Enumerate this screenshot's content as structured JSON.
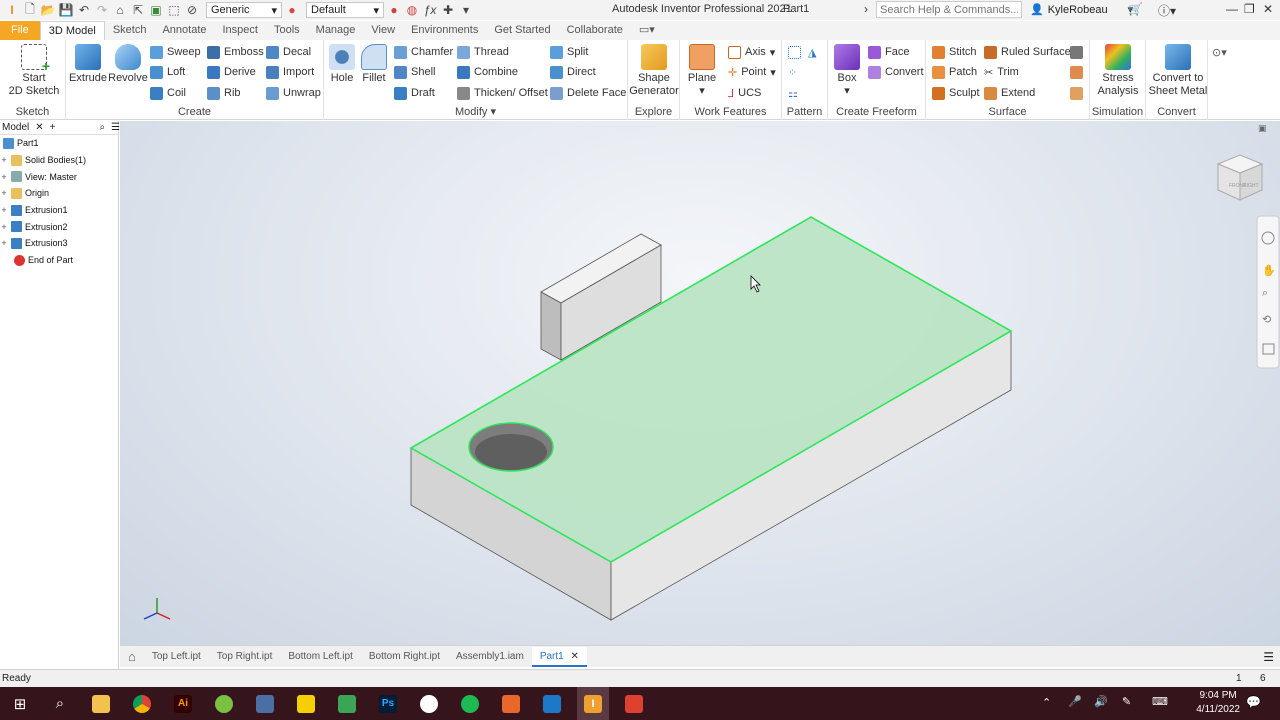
{
  "title_bar": {
    "app_title": "Autodesk Inventor Professional 2021",
    "doc_title": "Part1",
    "material": "Generic",
    "appearance": "Default",
    "search_placeholder": "Search Help & Commands...",
    "user": "KyleRobeau"
  },
  "ribbon_tabs": [
    "File",
    "3D Model",
    "Sketch",
    "Annotate",
    "Inspect",
    "Tools",
    "Manage",
    "View",
    "Environments",
    "Get Started",
    "Collaborate"
  ],
  "ribbon": {
    "sketch": {
      "label": "Sketch",
      "start": "Start",
      "start2": "2D Sketch"
    },
    "create": {
      "label": "Create",
      "extrude": "Extrude",
      "revolve": "Revolve",
      "sweep": "Sweep",
      "emboss": "Emboss",
      "decal": "Decal",
      "loft": "Loft",
      "derive": "Derive",
      "import": "Import",
      "coil": "Coil",
      "rib": "Rib",
      "unwrap": "Unwrap"
    },
    "modify": {
      "label": "Modify",
      "hole": "Hole",
      "fillet": "Fillet",
      "chamfer": "Chamfer",
      "thread": "Thread",
      "split": "Split",
      "shell": "Shell",
      "combine": "Combine",
      "direct": "Direct",
      "draft": "Draft",
      "thicken": "Thicken/ Offset",
      "delete_face": "Delete Face"
    },
    "explore": {
      "label": "Explore",
      "shape1": "Shape",
      "shape2": "Generator"
    },
    "work": {
      "label": "Work Features",
      "plane": "Plane",
      "axis": "Axis",
      "point": "Point",
      "ucs": "UCS"
    },
    "pattern": {
      "label": "Pattern"
    },
    "freeform": {
      "label": "Create Freeform",
      "box": "Box",
      "face": "Face",
      "convert": "Convert"
    },
    "surface": {
      "label": "Surface",
      "stitch": "Stitch",
      "ruled": "Ruled Surface",
      "patch": "Patch",
      "trim": "Trim",
      "sculpt": "Sculpt",
      "extend": "Extend"
    },
    "simulation": {
      "label": "Simulation",
      "stress1": "Stress",
      "stress2": "Analysis"
    },
    "convert": {
      "label": "Convert",
      "c1": "Convert to",
      "c2": "Sheet Metal"
    }
  },
  "browser": {
    "tab": "Model",
    "items": [
      "Part1",
      "Solid Bodies(1)",
      "View: Master",
      "Origin",
      "Extrusion1",
      "Extrusion2",
      "Extrusion3",
      "End of Part"
    ]
  },
  "doc_tabs": [
    "Top Left.ipt",
    "Top Right.ipt",
    "Bottom Left.ipt",
    "Bottom Right.ipt",
    "Assembly1.iam",
    "Part1"
  ],
  "status": {
    "text": "Ready",
    "n1": "1",
    "n2": "6"
  },
  "viewcube": {
    "face1": "FRONT",
    "face2": "RIGHT"
  },
  "clock": {
    "time": "9:04 PM",
    "date": "4/11/2022"
  }
}
